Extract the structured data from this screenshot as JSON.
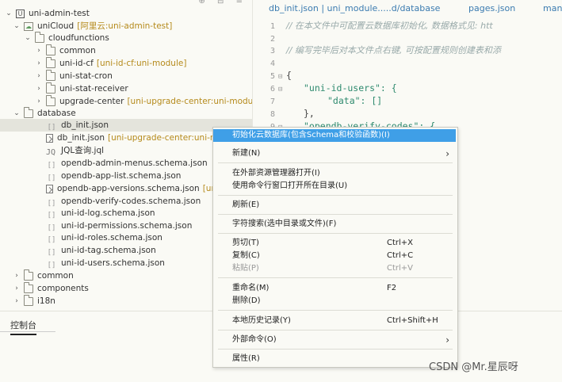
{
  "tree": {
    "top_icons": "⊕ ⊟ ≡",
    "root": "uni-admin-test",
    "unicloud": {
      "label": "uniCloud",
      "tag": "[阿里云:uni-admin-test]"
    },
    "cloudfunctions": "cloudfunctions",
    "cf_items": [
      {
        "label": "common",
        "tag": ""
      },
      {
        "label": "uni-id-cf",
        "tag": "[uni-id-cf:uni-module]"
      },
      {
        "label": "uni-stat-cron",
        "tag": ""
      },
      {
        "label": "uni-stat-receiver",
        "tag": ""
      },
      {
        "label": "upgrade-center",
        "tag": "[uni-upgrade-center:uni-module"
      }
    ],
    "database": "database",
    "db_items": [
      {
        "label": "db_init.json",
        "tag": ""
      },
      {
        "label": "db_init.json",
        "tag": "[uni-upgrade-center:uni-m"
      },
      {
        "label": "JQL查询.jql",
        "tag": ""
      },
      {
        "label": "opendb-admin-menus.schema.json",
        "tag": ""
      },
      {
        "label": "opendb-app-list.schema.json",
        "tag": ""
      },
      {
        "label": "opendb-app-versions.schema.json",
        "tag": "[uni"
      },
      {
        "label": "opendb-verify-codes.schema.json",
        "tag": ""
      },
      {
        "label": "uni-id-log.schema.json",
        "tag": ""
      },
      {
        "label": "uni-id-permissions.schema.json",
        "tag": ""
      },
      {
        "label": "uni-id-roles.schema.json",
        "tag": ""
      },
      {
        "label": "uni-id-tag.schema.json",
        "tag": ""
      },
      {
        "label": "uni-id-users.schema.json",
        "tag": ""
      }
    ],
    "bottom_items": [
      "common",
      "components",
      "i18n"
    ]
  },
  "panel": {
    "tab": "控制台"
  },
  "editor": {
    "tabs": [
      "db_init.json | uni_module.....d/database",
      "pages.json",
      "man"
    ],
    "lines": [
      {
        "n": "1",
        "text": "// 在本文件中可配置云数据库初始化, 数据格式见: htt"
      },
      {
        "n": "2",
        "text": ""
      },
      {
        "n": "3",
        "text": "// 编写完毕后对本文件点右键, 可按配置规则创建表和添"
      },
      {
        "n": "4",
        "text": ""
      },
      {
        "n": "5",
        "text": "{"
      },
      {
        "n": "6",
        "text": "\"uni-id-users\": {"
      },
      {
        "n": "7",
        "text": "\"data\": []"
      },
      {
        "n": "8",
        "text": "},"
      },
      {
        "n": "9",
        "text": "\"opendb-verify-codes\": {"
      }
    ]
  },
  "menu": {
    "items": [
      {
        "label": "初始化云数据库(包含Schema和校验函数)(I)",
        "shortcut": ""
      },
      {
        "label": "新建(N)",
        "shortcut": ""
      },
      {
        "label": "在外部资源管理器打开(I)",
        "shortcut": ""
      },
      {
        "label": "使用命令行窗口打开所在目录(U)",
        "shortcut": ""
      },
      {
        "label": "刷新(E)",
        "shortcut": ""
      },
      {
        "label": "字符搜索(选中目录或文件)(F)",
        "shortcut": ""
      },
      {
        "label": "剪切(T)",
        "shortcut": "Ctrl+X"
      },
      {
        "label": "复制(C)",
        "shortcut": "Ctrl+C"
      },
      {
        "label": "粘贴(P)",
        "shortcut": "Ctrl+V"
      },
      {
        "label": "重命名(M)",
        "shortcut": "F2"
      },
      {
        "label": "删除(D)",
        "shortcut": ""
      },
      {
        "label": "本地历史记录(Y)",
        "shortcut": "Ctrl+Shift+H"
      },
      {
        "label": "外部命令(O)",
        "shortcut": ""
      },
      {
        "label": "属性(R)",
        "shortcut": ""
      }
    ]
  },
  "watermark": "CSDN @Mr.星辰呀",
  "colors": {
    "highlight": "#3f9fe7",
    "tag": "#b58a1b",
    "key": "#2e8a6e",
    "comment": "#9aa0a0"
  }
}
